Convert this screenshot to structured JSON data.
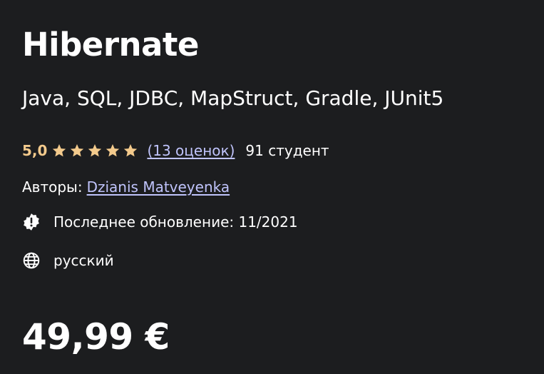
{
  "course": {
    "title": "Hibernate",
    "subtitle": "Java, SQL, JDBC, MapStruct, Gradle, JUnit5"
  },
  "rating": {
    "value": "5,0",
    "stars": 5,
    "count_label": "(13 оценок)",
    "students_label": "91 студент",
    "star_color": "#f3ca8c"
  },
  "authors": {
    "label": "Авторы:",
    "name": "Dzianis Matveyenka"
  },
  "updated": {
    "icon": "alert-badge-icon",
    "label": "Последнее обновление: 11/2021"
  },
  "language": {
    "icon": "globe-icon",
    "label": "русский"
  },
  "price": {
    "label": "49,99 €"
  },
  "colors": {
    "background": "#1c1d1f",
    "text": "#ffffff",
    "link": "#c0c4fc",
    "rating": "#f3ca8c"
  }
}
